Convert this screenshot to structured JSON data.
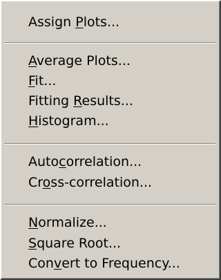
{
  "menu": {
    "groups": [
      {
        "items": [
          {
            "pre": "Assign ",
            "key": "P",
            "post": "lots..."
          }
        ]
      },
      {
        "items": [
          {
            "pre": "",
            "key": "A",
            "post": "verage Plots..."
          },
          {
            "pre": "",
            "key": "F",
            "post": "it..."
          },
          {
            "pre": "Fitting ",
            "key": "R",
            "post": "esults..."
          },
          {
            "pre": "",
            "key": "H",
            "post": "istogram..."
          }
        ]
      },
      {
        "items": [
          {
            "pre": "Auto",
            "key": "c",
            "post": "orrelation..."
          },
          {
            "pre": "Cr",
            "key": "o",
            "post": "ss-correlation..."
          }
        ]
      },
      {
        "items": [
          {
            "pre": "",
            "key": "N",
            "post": "ormalize..."
          },
          {
            "pre": "",
            "key": "S",
            "post": "quare Root..."
          },
          {
            "pre": "Con",
            "key": "v",
            "post": "ert to Frequency..."
          }
        ]
      }
    ]
  }
}
